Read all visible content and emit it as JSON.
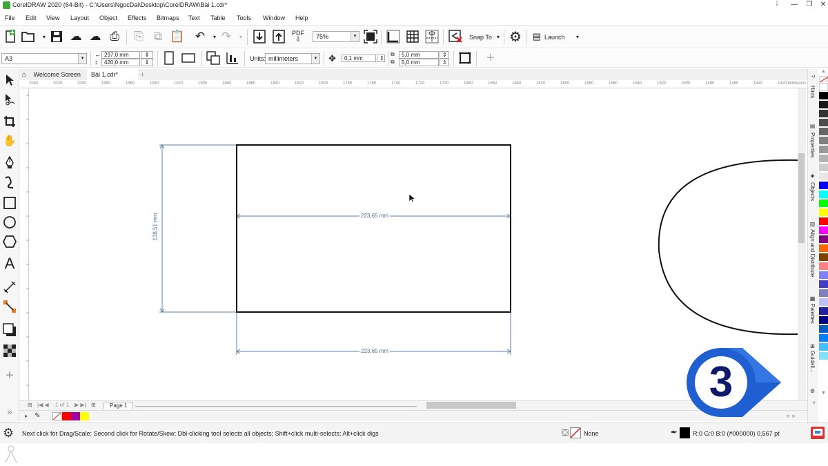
{
  "window": {
    "title": "CorelDRAW 2020 (64-Bit) - C:\\Users\\NgocDai\\Desktop\\CorelDRAW\\Bài 1.cdr*"
  },
  "menu": [
    "File",
    "Edit",
    "View",
    "Layout",
    "Object",
    "Effects",
    "Bitmaps",
    "Text",
    "Table",
    "Tools",
    "Window",
    "Help"
  ],
  "toolbar": {
    "zoom": "75%",
    "pdf_label": "PDF",
    "snap_to": "Snap To",
    "launch": "Launch"
  },
  "property_bar": {
    "page_size": "A3",
    "width": "297,0 mm",
    "height": "420,0 mm",
    "units_label": "Units:",
    "units_value": "millimeters",
    "nudge": "0,1 mm",
    "dup_x": "5,0 mm",
    "dup_y": "5,0 mm"
  },
  "tabs": [
    {
      "label": "Welcome Screen"
    },
    {
      "label": "Bài 1.cdr*"
    }
  ],
  "ruler": {
    "ticks": [
      "2040",
      "2020",
      "2000",
      "1980",
      "1960",
      "1940",
      "1920",
      "1900",
      "1880",
      "1860",
      "1840",
      "1820",
      "1800",
      "1780",
      "1760",
      "1740",
      "1720",
      "1700",
      "1680",
      "1660",
      "1640",
      "1620",
      "1600",
      "1580",
      "1560",
      "1540",
      "1520",
      "1500",
      "1480",
      "1460",
      "1440",
      "1420"
    ],
    "unit": "millimeters"
  },
  "canvas": {
    "dim_width_inner": "223,65 mm",
    "dim_width_outer": "223,65 mm",
    "dim_height": "138,51 mm"
  },
  "docker_tabs": [
    "Hints",
    "Properties",
    "Objects",
    "Align and Distribute",
    "Palettes",
    "Guideli..."
  ],
  "page_nav": {
    "page_of": "1 of 1",
    "page_tab": "Page 1"
  },
  "document_palette": [
    "#ff0000",
    "#a000a0",
    "#ffff00"
  ],
  "palette_colors": [
    "#ffffff",
    "#000000",
    "#1a1a1a",
    "#333333",
    "#4d4d4d",
    "#666666",
    "#808080",
    "#999999",
    "#b3b3b3",
    "#cccccc",
    "#e6e6e6",
    "#0000ff",
    "#00ffff",
    "#00ff00",
    "#ffff00",
    "#ff0000",
    "#ff00ff",
    "#800080",
    "#ff6600",
    "#804000",
    "#ff8080",
    "#8080ff",
    "#4040c0",
    "#8080c0",
    "#c0c0ff",
    "#2020a0",
    "#000080",
    "#0060c0",
    "#0080ff",
    "#40c0ff",
    "#80e0ff"
  ],
  "status": {
    "hint": "Next click for Drag/Scale; Second click for Rotate/Skew; Dbl-clicking tool selects all objects; Shift+click multi-selects; Alt+click digs",
    "fill": "None",
    "outline": "R:0 G:0 B:0 (#000000)  0,567 pt"
  },
  "badge": {
    "number": "3",
    "color": "#1f5fd1"
  }
}
